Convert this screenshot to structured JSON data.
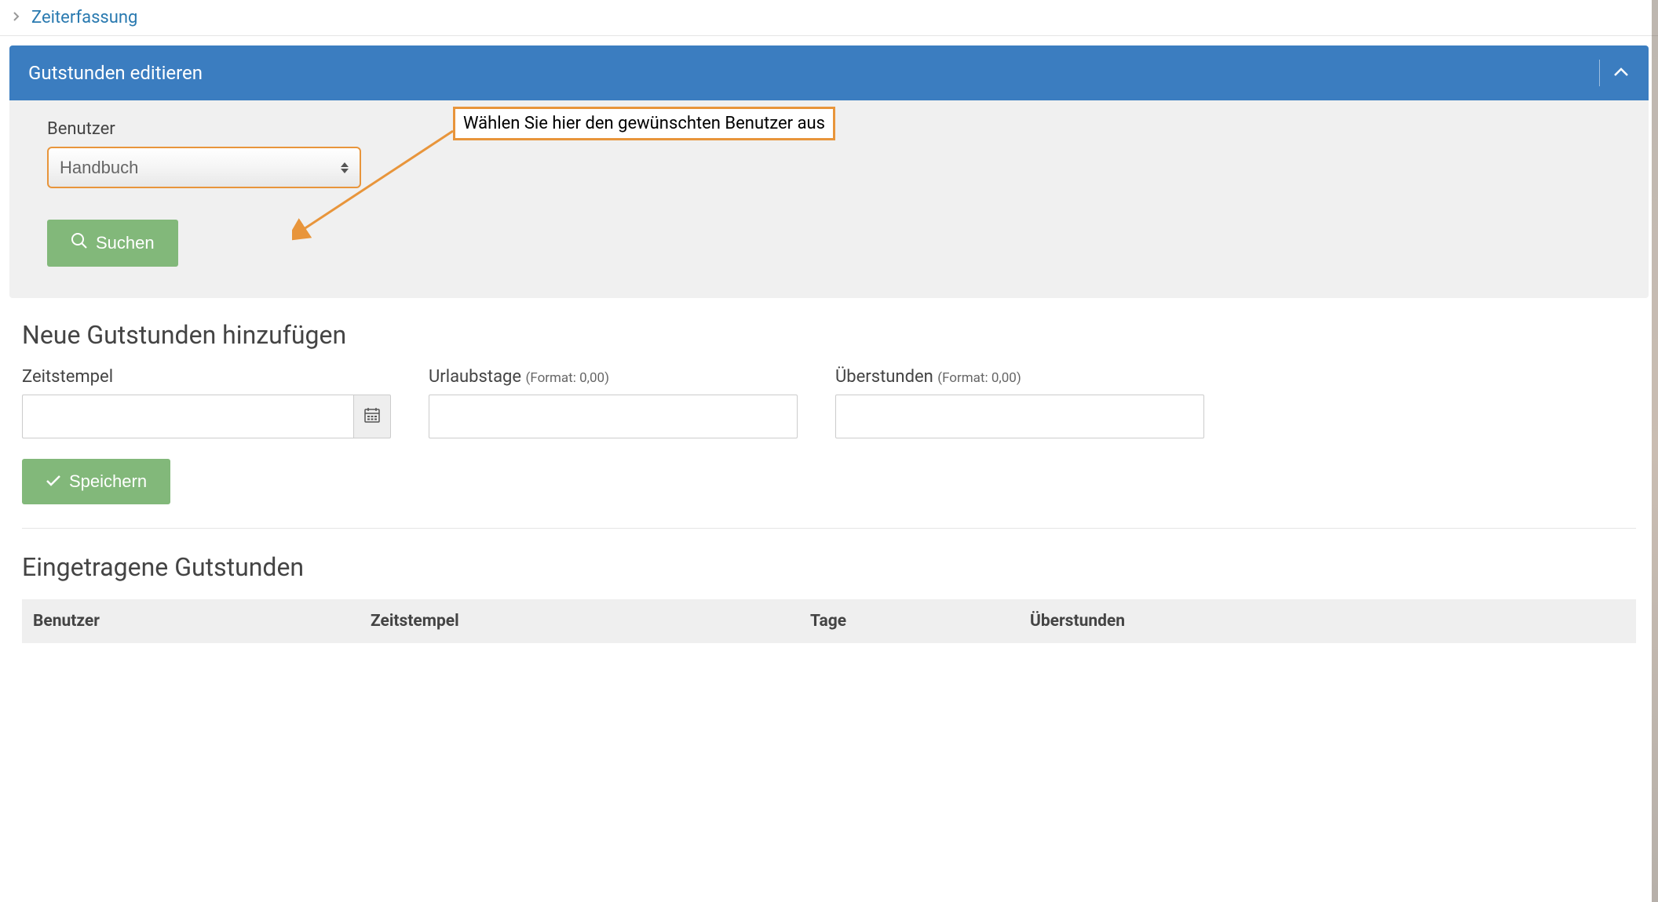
{
  "breadcrumb": {
    "link": "Zeiterfassung"
  },
  "panel": {
    "title": "Gutstunden editieren",
    "user_label": "Benutzer",
    "user_selected": "Handbuch",
    "search_label": "Suchen",
    "callout_text": "Wählen Sie hier den gewünschten Benutzer aus"
  },
  "add_section": {
    "title": "Neue Gutstunden hinzufügen",
    "timestamp_label": "Zeitstempel",
    "vacation_label": "Urlaubstage",
    "vacation_hint": "(Format: 0,00)",
    "overtime_label": "Überstunden",
    "overtime_hint": "(Format: 0,00)",
    "save_label": "Speichern"
  },
  "list_section": {
    "title": "Eingetragene Gutstunden",
    "columns": {
      "user": "Benutzer",
      "timestamp": "Zeitstempel",
      "days": "Tage",
      "overtime": "Überstunden"
    }
  },
  "colors": {
    "primary": "#3b7dc0",
    "accent": "#e8953b",
    "success": "#82b87a"
  }
}
